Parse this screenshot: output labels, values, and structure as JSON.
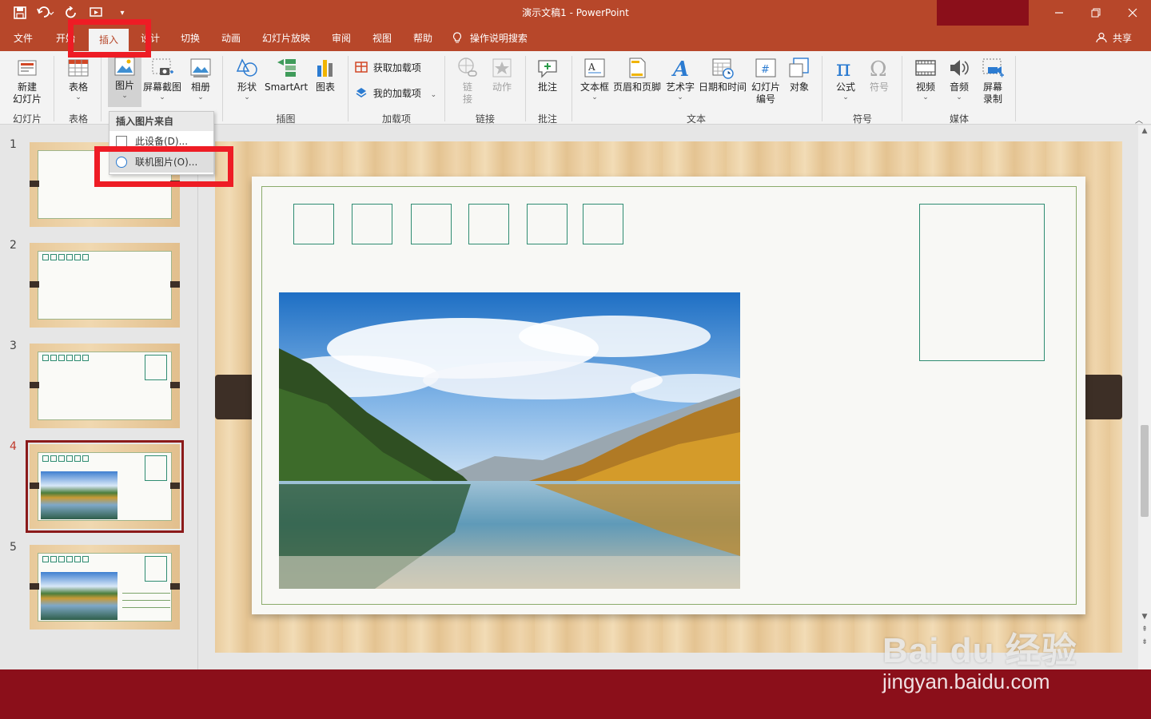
{
  "window": {
    "title": "演示文稿1  -  PowerPoint"
  },
  "tabs": [
    {
      "label": "文件"
    },
    {
      "label": "开始"
    },
    {
      "label": "插入"
    },
    {
      "label": "设计"
    },
    {
      "label": "切换"
    },
    {
      "label": "动画"
    },
    {
      "label": "幻灯片放映"
    },
    {
      "label": "审阅"
    },
    {
      "label": "视图"
    },
    {
      "label": "帮助"
    },
    {
      "label": "操作说明搜索"
    }
  ],
  "share_label": "共享",
  "ribbon": {
    "new_slide": "新建\n幻灯片",
    "table": "表格",
    "picture": "图片",
    "screenshot": "屏幕截图",
    "album": "相册",
    "shapes": "形状",
    "smartart": "SmartArt",
    "chart": "图表",
    "get_addins": "获取加载项",
    "my_addins": "我的加载项",
    "link": "链\n接",
    "action": "动作",
    "comment": "批注",
    "textbox": "文本框",
    "header_footer": "页眉和页脚",
    "wordart": "艺术字",
    "datetime": "日期和时间",
    "slide_number": "幻灯片\n编号",
    "object": "对象",
    "equation": "公式",
    "symbol": "符号",
    "video": "视频",
    "audio": "音频",
    "screen_recording": "屏幕\n录制",
    "groups": {
      "slides": "幻灯片",
      "tables": "表格",
      "images": "插图",
      "addins": "加载项",
      "links": "链接",
      "comments": "批注",
      "text": "文本",
      "symbols": "符号",
      "media": "媒体"
    }
  },
  "dropdown": {
    "header": "插入图片来自",
    "items": [
      "此设备(D)...",
      "联机图片(O)..."
    ]
  },
  "thumbnails": {
    "numbers": [
      "1",
      "2",
      "3",
      "4",
      "5"
    ],
    "selected": "4"
  },
  "watermark": {
    "brand": "Bai du 经验",
    "url": "jingyan.baidu.com"
  },
  "colors": {
    "accent": "#b7472a",
    "dark_red": "#8b0f1a",
    "highlight_box": "#ee1c25",
    "stamp_border": "#2f8c72"
  }
}
